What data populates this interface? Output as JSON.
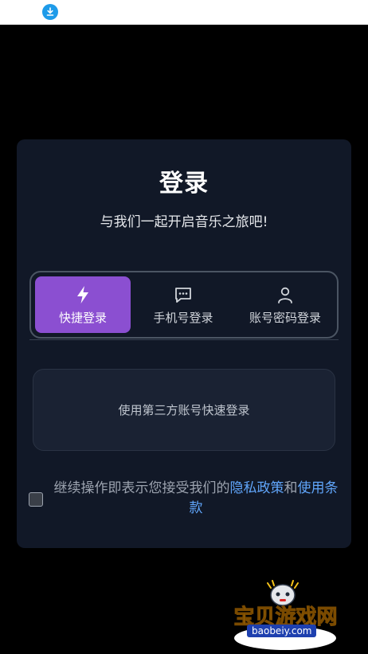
{
  "status_bar": {
    "icon": "download-icon"
  },
  "login": {
    "title": "登录",
    "subtitle": "与我们一起开启音乐之旅吧!"
  },
  "tabs": [
    {
      "label": "快捷登录",
      "icon": "lightning-icon",
      "active": true
    },
    {
      "label": "手机号登录",
      "icon": "message-icon",
      "active": false
    },
    {
      "label": "账号密码登录",
      "icon": "user-icon",
      "active": false
    }
  ],
  "third_party": {
    "label": "使用第三方账号快速登录"
  },
  "agreement": {
    "prefix": "继续操作即表示您接受我们的",
    "privacy_link": "隐私政策",
    "and": "和",
    "terms_link": "使用条款",
    "checked": false
  },
  "watermark": {
    "text": "宝贝游戏网",
    "url": "baobeiy.com"
  },
  "colors": {
    "accent": "#8b4fd1",
    "link": "#60a5fa",
    "card_bg": "#111827"
  }
}
